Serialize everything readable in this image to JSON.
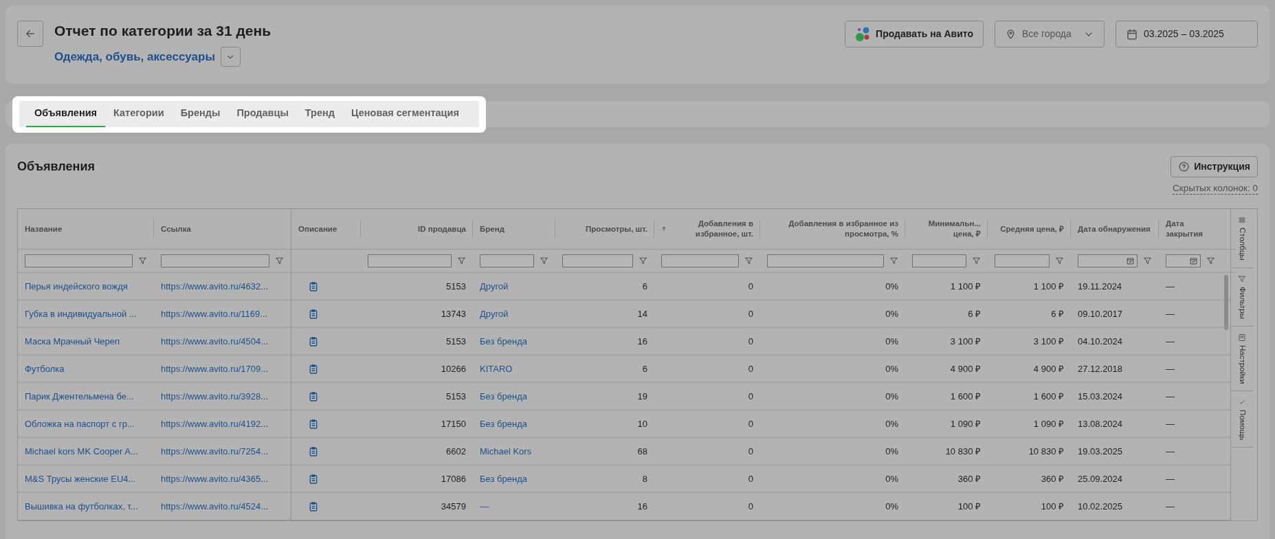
{
  "header": {
    "title": "Отчет по категории за 31 день",
    "category": "Одежда, обувь, аксессуары",
    "sell_button": "Продавать на Авито",
    "city_select": {
      "value": "Все города"
    },
    "date_range": "03.2025 – 03.2025"
  },
  "tabs_bar": {
    "highlighted": true,
    "tabs": [
      {
        "label": "Объявления",
        "selected": true
      },
      {
        "label": "Категории",
        "selected": false
      },
      {
        "label": "Бренды",
        "selected": false
      },
      {
        "label": "Продавцы",
        "selected": false
      },
      {
        "label": "Тренд",
        "selected": false
      },
      {
        "label": "Ценовая сегментация",
        "selected": false
      }
    ]
  },
  "section": {
    "title": "Объявления",
    "help_button": "Инструкция",
    "hidden_columns": "Скрытых колонок: 0"
  },
  "table": {
    "columns": [
      {
        "label": "Название",
        "kind": "link",
        "pinned": true
      },
      {
        "label": "Ссылка",
        "kind": "link",
        "pinned": true
      },
      {
        "label": "Описание",
        "kind": "icon"
      },
      {
        "label": "ID продавца",
        "kind": "number"
      },
      {
        "label": "Бренд",
        "kind": "link"
      },
      {
        "label": "Просмотры, шт.",
        "kind": "number"
      },
      {
        "label": "Добавления в избранное, шт.",
        "kind": "number",
        "sorted": true
      },
      {
        "label": "Добавления в избранное из просмотра, %",
        "kind": "number"
      },
      {
        "label": "Минимальн... цена, ₽",
        "kind": "number"
      },
      {
        "label": "Средняя цена, ₽",
        "kind": "number"
      },
      {
        "label": "Дата обнаружения",
        "kind": "date"
      },
      {
        "label": "Дата закрытия",
        "kind": "date"
      }
    ],
    "rows": [
      {
        "cells": [
          "Перья индейского вождя",
          "https://www.avito.ru/4632...",
          "",
          "5153",
          "Другой",
          "6",
          "0",
          "0%",
          "1 100 ₽",
          "1 100 ₽",
          "19.11.2024",
          "—"
        ]
      },
      {
        "cells": [
          "Губка в индивидуальной ...",
          "https://www.avito.ru/1169...",
          "",
          "13743",
          "Другой",
          "14",
          "0",
          "0%",
          "6 ₽",
          "6 ₽",
          "09.10.2017",
          "—"
        ]
      },
      {
        "cells": [
          "Маска Мрачный Череп",
          "https://www.avito.ru/4504...",
          "",
          "5153",
          "Без бренда",
          "16",
          "0",
          "0%",
          "3 100 ₽",
          "3 100 ₽",
          "04.10.2024",
          "—"
        ]
      },
      {
        "cells": [
          "Футболка",
          "https://www.avito.ru/1709...",
          "",
          "10266",
          "KITARO",
          "6",
          "0",
          "0%",
          "4 900 ₽",
          "4 900 ₽",
          "27.12.2018",
          "—"
        ]
      },
      {
        "cells": [
          "Парик Джентельмена бе...",
          "https://www.avito.ru/3928...",
          "",
          "5153",
          "Без бренда",
          "19",
          "0",
          "0%",
          "1 600 ₽",
          "1 600 ₽",
          "15.03.2024",
          "—"
        ]
      },
      {
        "cells": [
          "Обложка на паспорт с гр...",
          "https://www.avito.ru/4192...",
          "",
          "17150",
          "Без бренда",
          "10",
          "0",
          "0%",
          "1 090 ₽",
          "1 090 ₽",
          "13.08.2024",
          "—"
        ]
      },
      {
        "cells": [
          "Michael kors MK Cooper A...",
          "https://www.avito.ru/7254...",
          "",
          "6602",
          "Michael Kors",
          "68",
          "0",
          "0%",
          "10 830 ₽",
          "10 830 ₽",
          "19.03.2025",
          "—"
        ]
      },
      {
        "cells": [
          "M&S Трусы женские EU4...",
          "https://www.avito.ru/4365...",
          "",
          "17086",
          "Без бренда",
          "8",
          "0",
          "0%",
          "360 ₽",
          "360 ₽",
          "25.09.2024",
          "—"
        ]
      },
      {
        "cells": [
          "Вышивка на футболках, т...",
          "https://www.avito.ru/4524...",
          "",
          "34579",
          "—",
          "16",
          "0",
          "0%",
          "100 ₽",
          "100 ₽",
          "10.02.2025",
          "—"
        ]
      }
    ]
  },
  "side_panel": [
    {
      "label": "Столбцы",
      "kind": "columns"
    },
    {
      "label": "Фильтры",
      "kind": "filters"
    },
    {
      "label": "Настройки",
      "kind": "settings"
    },
    {
      "label": "Помощь",
      "kind": "help"
    }
  ]
}
